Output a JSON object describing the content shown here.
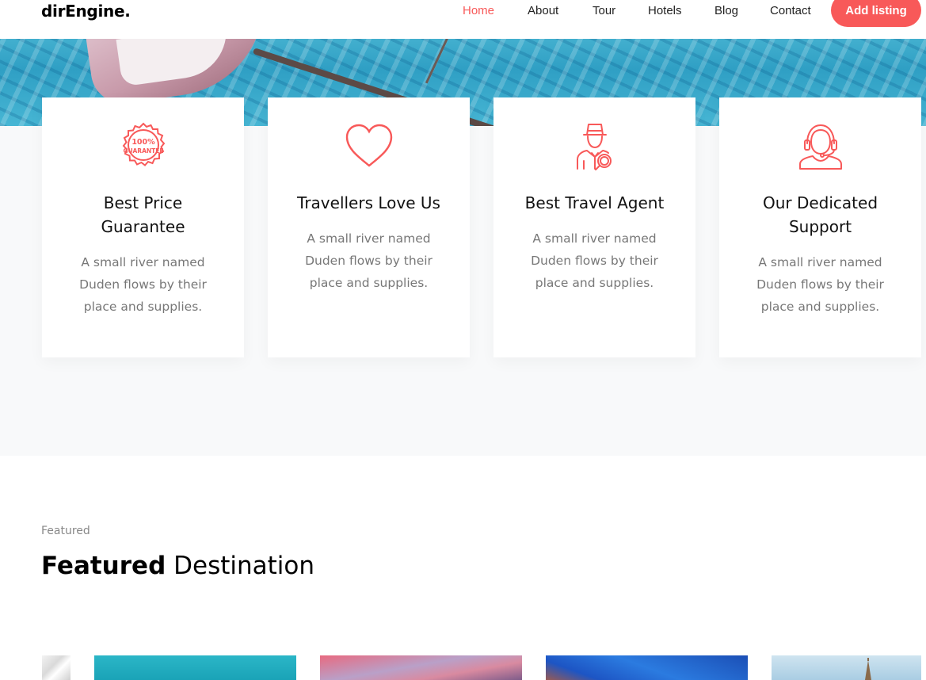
{
  "brand": "dirEngine.",
  "nav": {
    "links": [
      "Home",
      "About",
      "Tour",
      "Hotels",
      "Blog",
      "Contact"
    ],
    "active": "Home",
    "cta": "Add listing"
  },
  "colors": {
    "accent": "#f85959",
    "section_bg": "#f8f9fa",
    "text_muted": "#777777"
  },
  "services": [
    {
      "icon": "guarantee-badge-icon",
      "badge_top": "100%",
      "badge_bottom": "GUARANTEE",
      "title_lines": [
        "Best Price",
        "Guarantee"
      ],
      "desc_lines": [
        "A small river named",
        "Duden flows by their",
        "place and supplies."
      ]
    },
    {
      "icon": "heart-icon",
      "title_lines": [
        "Travellers Love Us"
      ],
      "desc_lines": [
        "A small river named",
        "Duden flows by their",
        "place and supplies."
      ]
    },
    {
      "icon": "travel-agent-icon",
      "title_lines": [
        "Best Travel Agent"
      ],
      "desc_lines": [
        "A small river named",
        "Duden flows by their",
        "place and supplies."
      ]
    },
    {
      "icon": "support-headset-icon",
      "title_lines": [
        "Our Dedicated",
        "Support"
      ],
      "desc_lines": [
        "A small river named",
        "Duden flows by their",
        "place and supplies."
      ]
    }
  ],
  "featured": {
    "subheading": "Featured",
    "heading_bold": "Featured",
    "heading_light": "Destination"
  }
}
